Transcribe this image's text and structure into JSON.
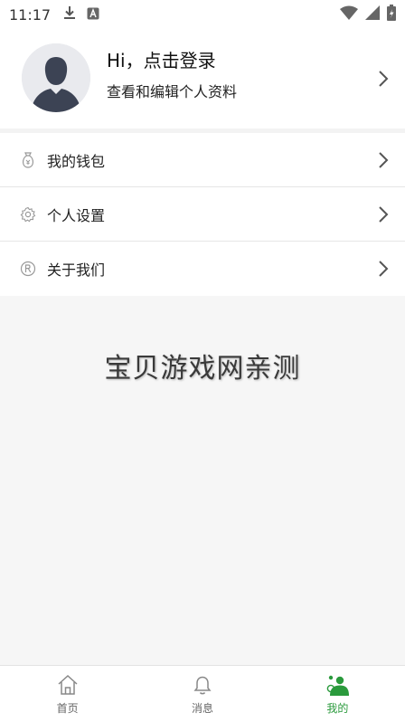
{
  "status_bar": {
    "time": "11:17"
  },
  "profile": {
    "title": "Hi，点击登录",
    "subtitle": "查看和编辑个人资料"
  },
  "menu": {
    "items": [
      {
        "label": "我的钱包",
        "icon": "wallet-icon"
      },
      {
        "label": "个人设置",
        "icon": "gear-icon"
      },
      {
        "label": "关于我们",
        "icon": "registered-icon"
      }
    ]
  },
  "watermark": "宝贝游戏网亲测",
  "bottom_nav": {
    "items": [
      {
        "label": "首页",
        "icon": "home-icon",
        "active": false
      },
      {
        "label": "消息",
        "icon": "bell-icon",
        "active": false
      },
      {
        "label": "我的",
        "icon": "profile-icon",
        "active": true
      }
    ],
    "active_color": "#2a9a3c"
  }
}
